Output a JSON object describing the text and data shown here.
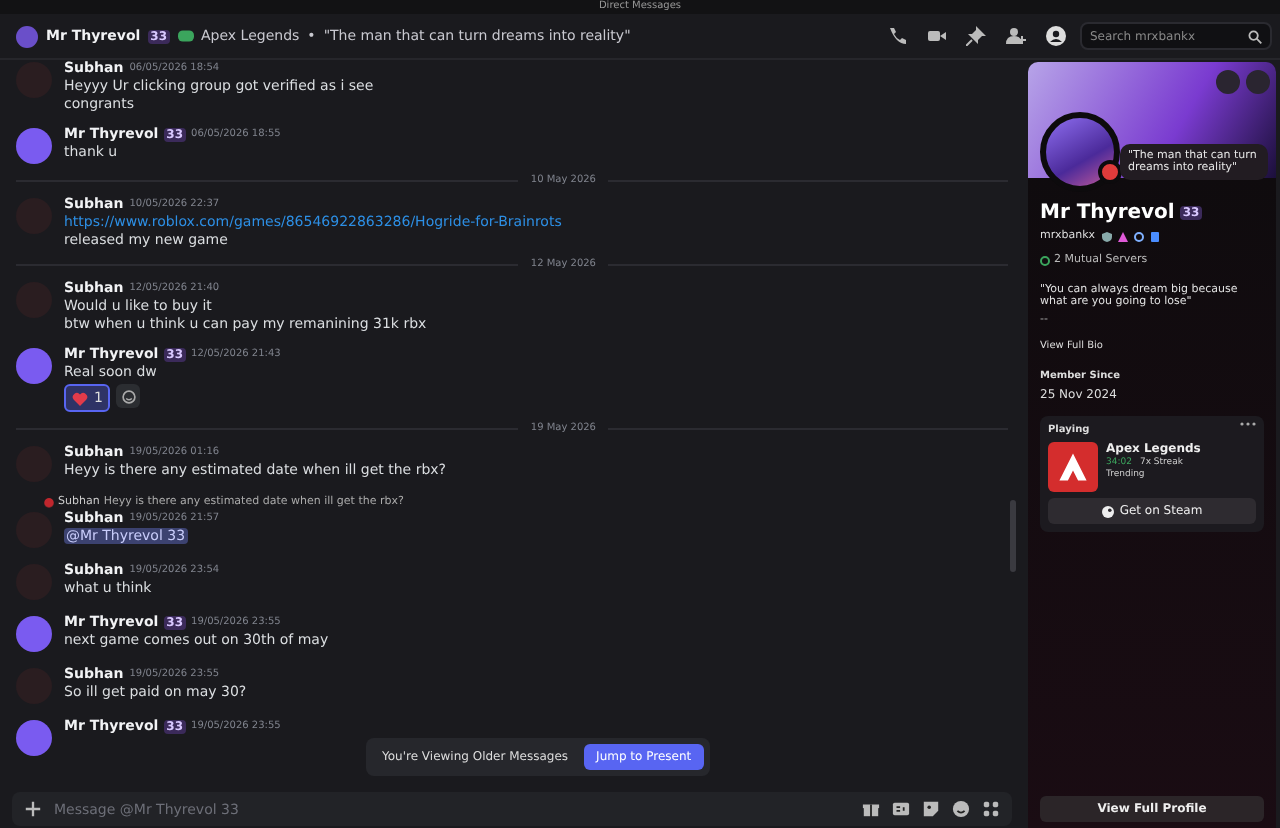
{
  "window": {
    "title": "Direct Messages"
  },
  "header": {
    "name": "Mr Thyrevol",
    "badge": "33",
    "game": "Apex Legends",
    "separator": "•",
    "status": "\"The man that can turn dreams into reality\"",
    "search": {
      "placeholder": "Search mrxbankx"
    }
  },
  "messages": [
    {
      "kind": "message",
      "color": "#2a1d20",
      "author": "Subhan",
      "time": "06/05/2026 18:54",
      "lines": [
        {
          "kind": "text",
          "text": "Heyyy Ur clicking group got verified as i see"
        },
        {
          "kind": "text",
          "text": "congrants"
        }
      ]
    },
    {
      "kind": "message",
      "color": "#7a5bf0",
      "author": "Mr Thyrevol",
      "badge": "33",
      "time": "06/05/2026 18:55",
      "lines": [
        {
          "kind": "text",
          "text": "thank u"
        }
      ]
    },
    {
      "kind": "divider",
      "text": "10 May 2026"
    },
    {
      "kind": "message",
      "color": "#2a1d20",
      "author": "Subhan",
      "time": "10/05/2026 22:37",
      "lines": [
        {
          "kind": "link",
          "text": "https://www.roblox.com/games/86546922863286/Hogride-for-Brainrots"
        },
        {
          "kind": "text",
          "text": "released my new game"
        }
      ]
    },
    {
      "kind": "divider",
      "text": "12 May 2026"
    },
    {
      "kind": "message",
      "color": "#2a1d20",
      "author": "Subhan",
      "time": "12/05/2026 21:40",
      "lines": [
        {
          "kind": "text",
          "text": "Would u like to buy it"
        },
        {
          "kind": "text",
          "text": "btw when u think u can pay my remanining 31k rbx"
        }
      ]
    },
    {
      "kind": "message",
      "color": "#7a5bf0",
      "author": "Mr Thyrevol",
      "badge": "33",
      "time": "12/05/2026 21:43",
      "lines": [
        {
          "kind": "text",
          "text": "Real soon dw"
        }
      ],
      "reactions": [
        {
          "count": "1",
          "selected": true
        }
      ]
    },
    {
      "kind": "divider",
      "text": "19 May 2026"
    },
    {
      "kind": "message",
      "color": "#2a1d20",
      "author": "Subhan",
      "time": "19/05/2026 01:16",
      "lines": [
        {
          "kind": "text",
          "text": "Heyy is there any estimated date when ill get the rbx?"
        }
      ]
    },
    {
      "kind": "message",
      "color": "#2a1d20",
      "author": "Subhan",
      "time": "19/05/2026 21:57",
      "reply": {
        "author": "Subhan",
        "text": "Heyy is there any estimated date when ill get the rbx?"
      },
      "lines": [
        {
          "kind": "mention",
          "text": "@Mr Thyrevol 33"
        }
      ]
    },
    {
      "kind": "message",
      "color": "#2a1d20",
      "author": "Subhan",
      "time": "19/05/2026 23:54",
      "lines": [
        {
          "kind": "text",
          "text": "what u think"
        }
      ]
    },
    {
      "kind": "message",
      "color": "#7a5bf0",
      "author": "Mr Thyrevol",
      "badge": "33",
      "time": "19/05/2026 23:55",
      "lines": [
        {
          "kind": "text",
          "text": "next game comes out on 30th of may"
        }
      ]
    },
    {
      "kind": "message",
      "color": "#2a1d20",
      "author": "Subhan",
      "time": "19/05/2026 23:55",
      "lines": [
        {
          "kind": "text",
          "text": "So ill get paid on may 30?"
        }
      ]
    },
    {
      "kind": "message",
      "color": "#7a5bf0",
      "author": "Mr Thyrevol",
      "badge": "33",
      "time": "19/05/2026 23:55"
    }
  ],
  "older_notice": {
    "text": "You're Viewing Older Messages",
    "button": "Jump to Present"
  },
  "composer": {
    "placeholder": "Message @Mr Thyrevol 33"
  },
  "profile": {
    "status": "\"The man that can turn dreams into reality\"",
    "name": "Mr Thyrevol",
    "badge": "33",
    "username": "mrxbankx",
    "mutual": "2 Mutual Servers",
    "bio": "\"You can always dream big because what are you going to lose\"",
    "bio_more": "--",
    "view_bio": "View Full Bio",
    "member_label": "Member Since",
    "member_date": "25 Nov 2024",
    "activity": {
      "label": "Playing",
      "game": "Apex Legends",
      "time": "34:02",
      "streak": "7x Streak",
      "trending": "Trending",
      "button": "Get on Steam"
    },
    "view_profile": "View Full Profile"
  }
}
